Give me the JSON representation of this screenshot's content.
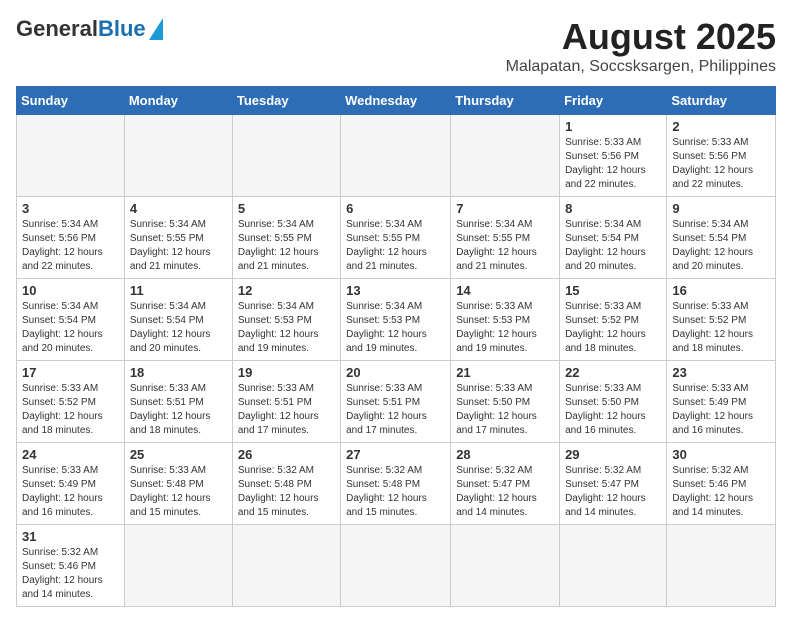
{
  "header": {
    "logo_general": "General",
    "logo_blue": "Blue",
    "month_title": "August 2025",
    "subtitle": "Malapatan, Soccsksargen, Philippines"
  },
  "weekdays": [
    "Sunday",
    "Monday",
    "Tuesday",
    "Wednesday",
    "Thursday",
    "Friday",
    "Saturday"
  ],
  "weeks": [
    [
      {
        "day": "",
        "info": ""
      },
      {
        "day": "",
        "info": ""
      },
      {
        "day": "",
        "info": ""
      },
      {
        "day": "",
        "info": ""
      },
      {
        "day": "",
        "info": ""
      },
      {
        "day": "1",
        "info": "Sunrise: 5:33 AM\nSunset: 5:56 PM\nDaylight: 12 hours and 22 minutes."
      },
      {
        "day": "2",
        "info": "Sunrise: 5:33 AM\nSunset: 5:56 PM\nDaylight: 12 hours and 22 minutes."
      }
    ],
    [
      {
        "day": "3",
        "info": "Sunrise: 5:34 AM\nSunset: 5:56 PM\nDaylight: 12 hours and 22 minutes."
      },
      {
        "day": "4",
        "info": "Sunrise: 5:34 AM\nSunset: 5:55 PM\nDaylight: 12 hours and 21 minutes."
      },
      {
        "day": "5",
        "info": "Sunrise: 5:34 AM\nSunset: 5:55 PM\nDaylight: 12 hours and 21 minutes."
      },
      {
        "day": "6",
        "info": "Sunrise: 5:34 AM\nSunset: 5:55 PM\nDaylight: 12 hours and 21 minutes."
      },
      {
        "day": "7",
        "info": "Sunrise: 5:34 AM\nSunset: 5:55 PM\nDaylight: 12 hours and 21 minutes."
      },
      {
        "day": "8",
        "info": "Sunrise: 5:34 AM\nSunset: 5:54 PM\nDaylight: 12 hours and 20 minutes."
      },
      {
        "day": "9",
        "info": "Sunrise: 5:34 AM\nSunset: 5:54 PM\nDaylight: 12 hours and 20 minutes."
      }
    ],
    [
      {
        "day": "10",
        "info": "Sunrise: 5:34 AM\nSunset: 5:54 PM\nDaylight: 12 hours and 20 minutes."
      },
      {
        "day": "11",
        "info": "Sunrise: 5:34 AM\nSunset: 5:54 PM\nDaylight: 12 hours and 20 minutes."
      },
      {
        "day": "12",
        "info": "Sunrise: 5:34 AM\nSunset: 5:53 PM\nDaylight: 12 hours and 19 minutes."
      },
      {
        "day": "13",
        "info": "Sunrise: 5:34 AM\nSunset: 5:53 PM\nDaylight: 12 hours and 19 minutes."
      },
      {
        "day": "14",
        "info": "Sunrise: 5:33 AM\nSunset: 5:53 PM\nDaylight: 12 hours and 19 minutes."
      },
      {
        "day": "15",
        "info": "Sunrise: 5:33 AM\nSunset: 5:52 PM\nDaylight: 12 hours and 18 minutes."
      },
      {
        "day": "16",
        "info": "Sunrise: 5:33 AM\nSunset: 5:52 PM\nDaylight: 12 hours and 18 minutes."
      }
    ],
    [
      {
        "day": "17",
        "info": "Sunrise: 5:33 AM\nSunset: 5:52 PM\nDaylight: 12 hours and 18 minutes."
      },
      {
        "day": "18",
        "info": "Sunrise: 5:33 AM\nSunset: 5:51 PM\nDaylight: 12 hours and 18 minutes."
      },
      {
        "day": "19",
        "info": "Sunrise: 5:33 AM\nSunset: 5:51 PM\nDaylight: 12 hours and 17 minutes."
      },
      {
        "day": "20",
        "info": "Sunrise: 5:33 AM\nSunset: 5:51 PM\nDaylight: 12 hours and 17 minutes."
      },
      {
        "day": "21",
        "info": "Sunrise: 5:33 AM\nSunset: 5:50 PM\nDaylight: 12 hours and 17 minutes."
      },
      {
        "day": "22",
        "info": "Sunrise: 5:33 AM\nSunset: 5:50 PM\nDaylight: 12 hours and 16 minutes."
      },
      {
        "day": "23",
        "info": "Sunrise: 5:33 AM\nSunset: 5:49 PM\nDaylight: 12 hours and 16 minutes."
      }
    ],
    [
      {
        "day": "24",
        "info": "Sunrise: 5:33 AM\nSunset: 5:49 PM\nDaylight: 12 hours and 16 minutes."
      },
      {
        "day": "25",
        "info": "Sunrise: 5:33 AM\nSunset: 5:48 PM\nDaylight: 12 hours and 15 minutes."
      },
      {
        "day": "26",
        "info": "Sunrise: 5:32 AM\nSunset: 5:48 PM\nDaylight: 12 hours and 15 minutes."
      },
      {
        "day": "27",
        "info": "Sunrise: 5:32 AM\nSunset: 5:48 PM\nDaylight: 12 hours and 15 minutes."
      },
      {
        "day": "28",
        "info": "Sunrise: 5:32 AM\nSunset: 5:47 PM\nDaylight: 12 hours and 14 minutes."
      },
      {
        "day": "29",
        "info": "Sunrise: 5:32 AM\nSunset: 5:47 PM\nDaylight: 12 hours and 14 minutes."
      },
      {
        "day": "30",
        "info": "Sunrise: 5:32 AM\nSunset: 5:46 PM\nDaylight: 12 hours and 14 minutes."
      }
    ],
    [
      {
        "day": "31",
        "info": "Sunrise: 5:32 AM\nSunset: 5:46 PM\nDaylight: 12 hours and 14 minutes."
      },
      {
        "day": "",
        "info": ""
      },
      {
        "day": "",
        "info": ""
      },
      {
        "day": "",
        "info": ""
      },
      {
        "day": "",
        "info": ""
      },
      {
        "day": "",
        "info": ""
      },
      {
        "day": "",
        "info": ""
      }
    ]
  ]
}
